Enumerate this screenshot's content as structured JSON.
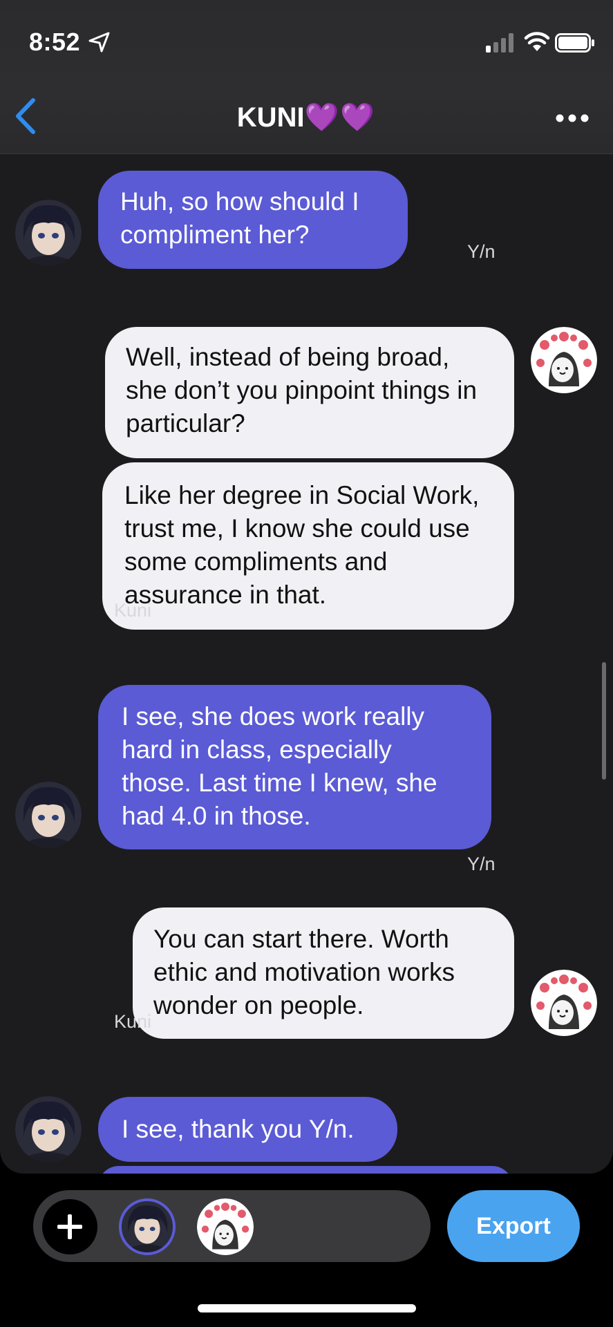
{
  "status_bar": {
    "time": "8:52"
  },
  "header": {
    "title": "KUNI",
    "title_emoji": "💜💜"
  },
  "messages": [
    {
      "text": "Huh, so how should I compliment her?",
      "sender": "Kuni"
    },
    {
      "sender": "Y/n",
      "text": "Well, instead of being broad, she don’t you pinpoint things in particular?"
    },
    {
      "text": "Like her degree in Social Work, trust me, I know she could use some compliments and assurance in that."
    },
    {
      "sender": "Kuni",
      "text": "I see, she does work really hard in class, especially those. Last time I knew, she had 4.0 in those."
    },
    {
      "sender": "Y/n",
      "text": "You can start there. Worth ethic and motivation works wonder on people."
    },
    {
      "sender": "Kuni",
      "text": "I see, thank you Y/n."
    }
  ],
  "bottom_bar": {
    "add_label": "+",
    "export_label": "Export"
  },
  "colors": {
    "left_bubble": "#5b5bd6",
    "right_bubble": "#f1f1f5",
    "export": "#4aa3ef",
    "chat_bg": "#1c1c1e"
  },
  "icons": [
    "location-arrow-icon",
    "signal-icon",
    "wifi-icon",
    "battery-icon",
    "back-chevron-icon",
    "more-dots-icon",
    "plus-icon"
  ]
}
